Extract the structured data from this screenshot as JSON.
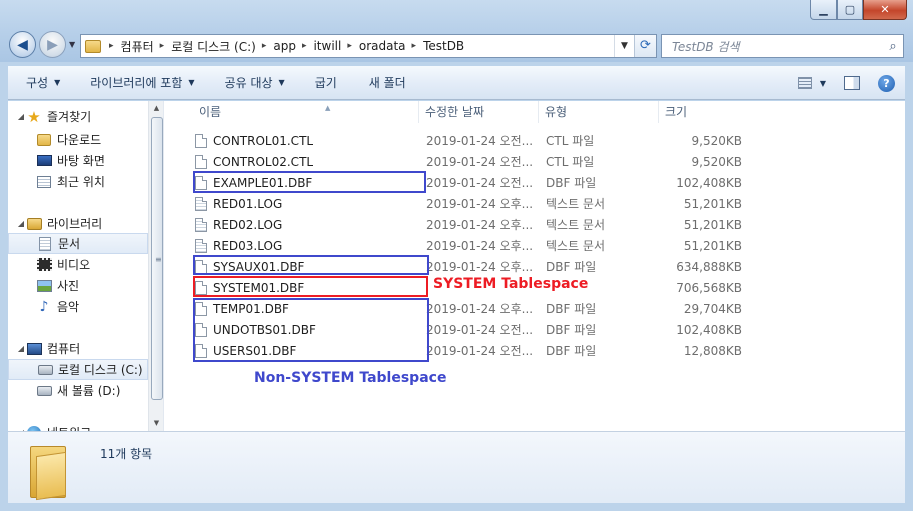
{
  "window": {
    "controls": {
      "minimize": "▁",
      "maximize": "▢",
      "close": "✕"
    }
  },
  "nav": {
    "back": "◀",
    "forward": "▶",
    "history": "▼"
  },
  "address": {
    "crumbs": [
      "컴퓨터",
      "로컬 디스크 (C:)",
      "app",
      "itwill",
      "oradata",
      "TestDB"
    ],
    "separator": "▸",
    "dropdown": "▼",
    "refresh": "⟳"
  },
  "search": {
    "placeholder": "TestDB 검색",
    "icon": "search-icon"
  },
  "toolbar": {
    "items": [
      {
        "label": "구성",
        "dropdown": true
      },
      {
        "label": "라이브러리에 포함",
        "dropdown": true
      },
      {
        "label": "공유 대상",
        "dropdown": true
      },
      {
        "label": "굽기",
        "dropdown": false
      },
      {
        "label": "새 폴더",
        "dropdown": false
      }
    ],
    "arrow": "▼",
    "help": "?"
  },
  "navpane": {
    "items": [
      {
        "label": "즐겨찾기",
        "icon": "star-icon",
        "group": true
      },
      {
        "label": "다운로드",
        "icon": "downloads-folder-icon"
      },
      {
        "label": "바탕 화면",
        "icon": "desktop-icon"
      },
      {
        "label": "최근 위치",
        "icon": "recent-places-icon"
      },
      {
        "label": "라이브러리",
        "icon": "libraries-icon",
        "group": true
      },
      {
        "label": "문서",
        "icon": "documents-icon",
        "selected": true
      },
      {
        "label": "비디오",
        "icon": "videos-icon"
      },
      {
        "label": "사진",
        "icon": "pictures-icon"
      },
      {
        "label": "음악",
        "icon": "music-icon"
      },
      {
        "label": "컴퓨터",
        "icon": "computer-icon",
        "group": true
      },
      {
        "label": "로컬 디스크 (C:)",
        "icon": "local-disk-icon",
        "selected": true
      },
      {
        "label": "새 볼륨 (D:)",
        "icon": "volume-icon"
      },
      {
        "label": "네트워크",
        "icon": "network-icon",
        "group": true
      }
    ],
    "scroll_up": "▲",
    "scroll_down": "▼",
    "grip": "≡"
  },
  "list": {
    "columns": [
      "이름",
      "수정한 날짜",
      "유형",
      "크기"
    ],
    "sort_arrow": "▲",
    "rows": [
      {
        "name": "CONTROL01.CTL",
        "date": "2019-01-24 오전...",
        "type": "CTL 파일",
        "size": "9,520KB"
      },
      {
        "name": "CONTROL02.CTL",
        "date": "2019-01-24 오전...",
        "type": "CTL 파일",
        "size": "9,520KB"
      },
      {
        "name": "EXAMPLE01.DBF",
        "date": "2019-01-24 오전...",
        "type": "DBF 파일",
        "size": "102,408KB"
      },
      {
        "name": "RED01.LOG",
        "date": "2019-01-24 오후...",
        "type": "텍스트 문서",
        "size": "51,201KB"
      },
      {
        "name": "RED02.LOG",
        "date": "2019-01-24 오후...",
        "type": "텍스트 문서",
        "size": "51,201KB"
      },
      {
        "name": "RED03.LOG",
        "date": "2019-01-24 오후...",
        "type": "텍스트 문서",
        "size": "51,201KB"
      },
      {
        "name": "SYSAUX01.DBF",
        "date": "2019-01-24 오후...",
        "type": "DBF 파일",
        "size": "634,888KB"
      },
      {
        "name": "SYSTEM01.DBF",
        "date": "",
        "type": "",
        "size": "706,568KB"
      },
      {
        "name": "TEMP01.DBF",
        "date": "2019-01-24 오후...",
        "type": "DBF 파일",
        "size": "29,704KB"
      },
      {
        "name": "UNDOTBS01.DBF",
        "date": "2019-01-24 오전...",
        "type": "DBF 파일",
        "size": "102,408KB"
      },
      {
        "name": "USERS01.DBF",
        "date": "2019-01-24 오전...",
        "type": "DBF 파일",
        "size": "12,808KB"
      }
    ]
  },
  "annotations": {
    "system": "SYSTEM Tablespace",
    "non_system": "Non-SYSTEM Tablespace",
    "colors": {
      "red": "#ed1c24",
      "blue": "#3f48cc"
    }
  },
  "status": {
    "count": "11개 항목"
  }
}
